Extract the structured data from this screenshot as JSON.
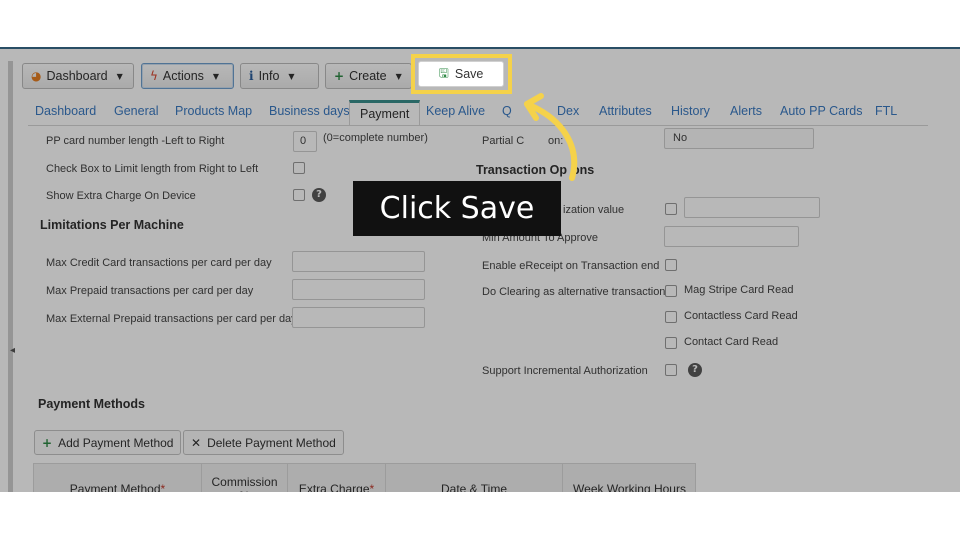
{
  "toolbar": {
    "dashboard_label": "Dashboard",
    "actions_label": "Actions",
    "info_label": "Info",
    "create_label": "Create",
    "save_label": "Save"
  },
  "tabs": [
    {
      "label": "Dashboard"
    },
    {
      "label": "General"
    },
    {
      "label": "Products Map"
    },
    {
      "label": "Business days"
    },
    {
      "label": "Payment"
    },
    {
      "label": "Keep Alive"
    },
    {
      "label": "Q"
    },
    {
      "label": "Dex"
    },
    {
      "label": "Attributes"
    },
    {
      "label": "History"
    },
    {
      "label": "Alerts"
    },
    {
      "label": "Auto PP Cards"
    },
    {
      "label": "FTL"
    }
  ],
  "left_form": {
    "pp_length_label": "PP card number length -Left to Right",
    "pp_length_value": "0",
    "pp_length_hint": "(0=complete number)",
    "limit_right_label": "Check Box to Limit length from Right to Left",
    "extra_charge_label": "Show Extra Charge On Device"
  },
  "limitations": {
    "title": "Limitations Per Machine",
    "credit_label": "Max Credit Card transactions per card per day",
    "prepaid_label": "Max Prepaid transactions per card per day",
    "external_label": "Max External Prepaid transactions per card per day"
  },
  "right_form": {
    "partial_label_a": "Partial C",
    "partial_label_b": "on:",
    "partial_value": "No",
    "transaction_title_a": "Transaction Op",
    "transaction_title_b": "ons",
    "auth_value_label": "ization value",
    "min_amount_label": "Min Amount To Approve",
    "ereceipt_label": "Enable eReceipt on Transaction end",
    "clearing_label": "Do Clearing as alternative transaction",
    "mag_stripe_label": "Mag Stripe Card Read",
    "contactless_label": "Contactless Card Read",
    "contact_label": "Contact Card Read",
    "incremental_label": "Support Incremental Authorization"
  },
  "payment_methods": {
    "title": "Payment Methods",
    "add_label": "Add Payment Method",
    "delete_label": "Delete Payment Method",
    "columns": {
      "method": "Payment Method",
      "commission": "Commission %",
      "extra_charge": "Extra Charge",
      "date_time": "Date & Time",
      "week_hours": "Week Working Hours"
    },
    "required_mark": "*"
  },
  "guide": {
    "tooltip_text": "Click Save",
    "highlight_color": "#f5d24a",
    "arrow_color": "#f5d24a"
  },
  "icons": {
    "dashboard": "pie-chart-icon",
    "actions": "bolt-icon",
    "info": "info-icon",
    "create": "plus-icon",
    "save": "floppy-disk-icon",
    "add": "plus-icon",
    "delete": "close-icon",
    "help": "question-circle-icon"
  }
}
